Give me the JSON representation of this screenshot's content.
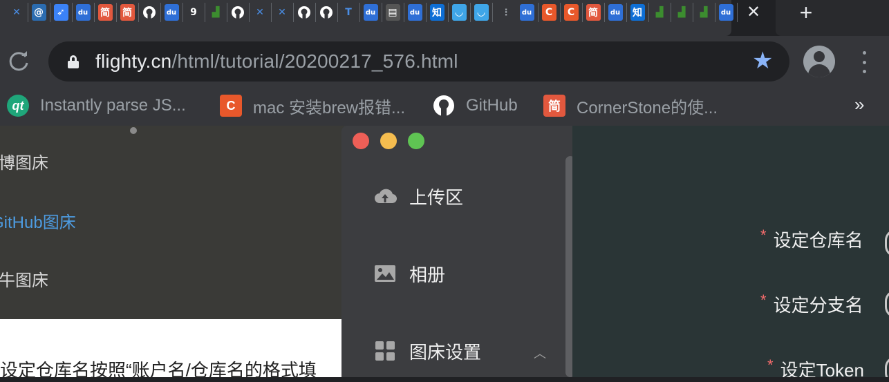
{
  "tabs": {
    "favicons": [
      {
        "icon": "tools-x-icon",
        "glyph": "✕",
        "bg": "#35363a",
        "fg": "#4a8ee6"
      },
      {
        "icon": "swirl-icon",
        "glyph": "@",
        "bg": "#2b6cb0",
        "fg": "#ffffff"
      },
      {
        "icon": "feather-icon",
        "glyph": "➶",
        "bg": "#3b82f6",
        "fg": "#ffffff"
      },
      {
        "icon": "baidu-icon",
        "glyph": "du",
        "bg": "#2f6fd6",
        "fg": "#ffffff"
      },
      {
        "icon": "jianshu-icon",
        "glyph": "简",
        "bg": "#e2583e",
        "fg": "#ffffff"
      },
      {
        "icon": "jianshu-icon",
        "glyph": "简",
        "bg": "#e2583e",
        "fg": "#ffffff"
      },
      {
        "icon": "github-icon",
        "glyph": "",
        "bg": "#35363a",
        "fg": "#ffffff"
      },
      {
        "icon": "baidu-icon",
        "glyph": "du",
        "bg": "#2f6fd6",
        "fg": "#ffffff"
      },
      {
        "icon": "swirl-icon",
        "glyph": "9",
        "bg": "#35363a",
        "fg": "#ffffff"
      },
      {
        "icon": "signal-icon",
        "glyph": "▟",
        "bg": "#35363a",
        "fg": "#3c8d2f"
      },
      {
        "icon": "github-icon",
        "glyph": "",
        "bg": "#35363a",
        "fg": "#ffffff"
      },
      {
        "icon": "tools-x-icon",
        "glyph": "✕",
        "bg": "#35363a",
        "fg": "#4a8ee6"
      },
      {
        "icon": "tools-x-icon",
        "glyph": "✕",
        "bg": "#35363a",
        "fg": "#4a8ee6"
      },
      {
        "icon": "github-icon",
        "glyph": "",
        "bg": "#35363a",
        "fg": "#ffffff"
      },
      {
        "icon": "github-icon",
        "glyph": "",
        "bg": "#35363a",
        "fg": "#ffffff"
      },
      {
        "icon": "typora-icon",
        "glyph": "T",
        "bg": "#35363a",
        "fg": "#4a8ee6"
      },
      {
        "icon": "baidu-icon",
        "glyph": "du",
        "bg": "#2f6fd6",
        "fg": "#ffffff"
      },
      {
        "icon": "terminal-icon",
        "glyph": "▤",
        "bg": "#555555",
        "fg": "#ffffff"
      },
      {
        "icon": "baidu-icon",
        "glyph": "du",
        "bg": "#2f6fd6",
        "fg": "#ffffff"
      },
      {
        "icon": "zhihu-icon",
        "glyph": "知",
        "bg": "#0e6fd6",
        "fg": "#ffffff"
      },
      {
        "icon": "cup-icon",
        "glyph": "◡",
        "bg": "#3fa6e8",
        "fg": "#ffffff"
      },
      {
        "icon": "cup-icon",
        "glyph": "◡",
        "bg": "#3fa6e8",
        "fg": "#ffffff"
      }
    ],
    "favicons_right": [
      {
        "icon": "baidu-icon",
        "glyph": "du",
        "bg": "#2f6fd6",
        "fg": "#ffffff"
      },
      {
        "icon": "csdn-icon",
        "glyph": "C",
        "bg": "#e8582b",
        "fg": "#ffffff"
      },
      {
        "icon": "csdn-icon",
        "glyph": "C",
        "bg": "#e8582b",
        "fg": "#ffffff"
      },
      {
        "icon": "jianshu-icon",
        "glyph": "简",
        "bg": "#e2583e",
        "fg": "#ffffff"
      },
      {
        "icon": "baidu-icon",
        "glyph": "du",
        "bg": "#2f6fd6",
        "fg": "#ffffff"
      },
      {
        "icon": "zhihu-icon",
        "glyph": "知",
        "bg": "#0e6fd6",
        "fg": "#ffffff"
      },
      {
        "icon": "signal-icon",
        "glyph": "▟",
        "bg": "#35363a",
        "fg": "#3c8d2f"
      },
      {
        "icon": "signal-icon",
        "glyph": "▟",
        "bg": "#35363a",
        "fg": "#3c8d2f"
      },
      {
        "icon": "signal-icon",
        "glyph": "▟",
        "bg": "#35363a",
        "fg": "#3c8d2f"
      },
      {
        "icon": "baidu-icon",
        "glyph": "du",
        "bg": "#2f6fd6",
        "fg": "#ffffff"
      }
    ],
    "close_glyph": "✕",
    "new_glyph": "+"
  },
  "toolbar": {
    "url_host": "flighty.cn",
    "url_path": "/html/tutorial/20200217_576.html"
  },
  "bookmarks": [
    {
      "icon": "qt-icon",
      "glyph": "qt",
      "bg": "#1fa67a",
      "label": "Instantly parse JS..."
    },
    {
      "icon": "csdn-icon",
      "glyph": "C",
      "bg": "#e8582b",
      "label": "mac 安装brew报错..."
    },
    {
      "icon": "github-icon",
      "glyph": "",
      "bg": "#35363a",
      "label": "GitHub"
    },
    {
      "icon": "jianshu-icon",
      "glyph": "简",
      "bg": "#e2583e",
      "label": "CornerStone的使..."
    }
  ],
  "bookmarks_more": "»",
  "page": {
    "nav": [
      "微博图床",
      "GitHub图床",
      "七牛图床"
    ],
    "body_text": "设定仓库名按照“账户名/仓库名的格式填"
  },
  "app": {
    "menu": [
      {
        "icon": "cloud-upload-icon",
        "label": "上传区"
      },
      {
        "icon": "image-icon",
        "label": "相册"
      },
      {
        "icon": "grid-icon",
        "label": "图床设置"
      }
    ],
    "form": [
      {
        "required": "*",
        "label": "设定仓库名"
      },
      {
        "required": "*",
        "label": "设定分支名"
      },
      {
        "required": "*",
        "label": "设定Token"
      }
    ]
  }
}
